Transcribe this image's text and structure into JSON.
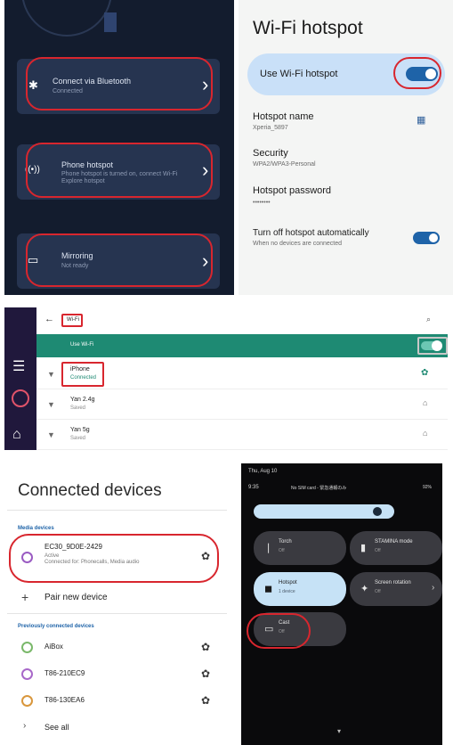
{
  "car_menu": {
    "items": [
      {
        "title": "Connect via Bluetooth",
        "sub": "Connected",
        "icon": "bluetooth-icon"
      },
      {
        "title": "Phone hotspot",
        "sub": "Phone hotspot is turned on, connect Wi-Fi",
        "sub2": "Explore hotspot",
        "icon": "hotspot-icon"
      },
      {
        "title": "Mirroring",
        "sub": "Not ready",
        "icon": "mirroring-icon"
      }
    ]
  },
  "hotspot": {
    "title": "Wi-Fi hotspot",
    "use_label": "Use Wi-Fi hotspot",
    "name_label": "Hotspot name",
    "name_value": "Xperia_5897",
    "security_label": "Security",
    "security_value": "WPA2/WPA3-Personal",
    "password_label": "Hotspot password",
    "password_value": "••••••••",
    "auto_off_label": "Turn off hotspot automatically",
    "auto_off_sub": "When no devices are connected"
  },
  "wifi": {
    "title": "Wi-Fi",
    "use_label": "Use Wi-Fi",
    "networks": [
      {
        "name": "iPhone",
        "status": "Connected"
      },
      {
        "name": "Yan 2.4g",
        "status": "Saved"
      },
      {
        "name": "Yan 5g",
        "status": "Saved"
      }
    ]
  },
  "devices": {
    "title": "Connected devices",
    "media_header": "Media devices",
    "active_name": "EC30_9D0E-2429",
    "active_status": "Active",
    "active_desc": "Connected for: Phonecalls, Media audio",
    "pair_label": "Pair new device",
    "prev_header": "Previously connected devices",
    "previous": [
      "AiBox",
      "T86-210EC9",
      "T86-130EA6"
    ],
    "see_all": "See all"
  },
  "quick": {
    "date": "Thu, Aug 10",
    "time": "9:35",
    "status_text": "No SIM card - 緊急通報のみ",
    "battery": "92%",
    "tiles": [
      {
        "label": "Torch",
        "sub": "Off",
        "on": false
      },
      {
        "label": "STAMINA mode",
        "sub": "Off",
        "on": false
      },
      {
        "label": "Hotspot",
        "sub": "1 device",
        "on": true
      },
      {
        "label": "Screen rotation",
        "sub": "Off",
        "on": false
      },
      {
        "label": "Cast",
        "sub": "Off",
        "on": false
      }
    ]
  },
  "colors": {
    "highlight": "#d8262e",
    "toggle_blue": "#1e63a8",
    "wifi_green": "#1e8a73",
    "car_bg": "#131c2e"
  }
}
